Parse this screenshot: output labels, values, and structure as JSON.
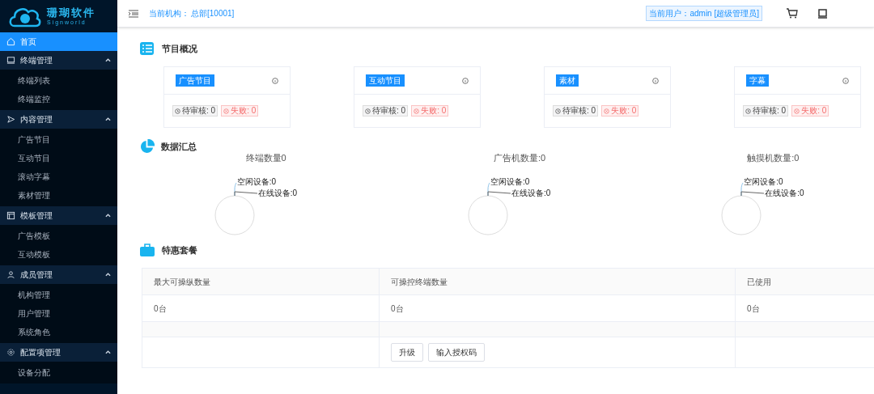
{
  "logo": {
    "name": "珊瑚软件",
    "sub": "Signworld"
  },
  "sidebar": {
    "items": [
      {
        "label": "首页",
        "selected": true
      },
      {
        "label": "终端管理",
        "expanded": true,
        "children": [
          {
            "label": "终端列表",
            "selected": false
          },
          {
            "label": "终端监控",
            "selected": false
          }
        ]
      },
      {
        "label": "内容管理",
        "expanded": true,
        "children": [
          {
            "label": "广告节目",
            "selected": false
          },
          {
            "label": "互动节目",
            "selected": false
          },
          {
            "label": "滚动字幕",
            "selected": false
          },
          {
            "label": "素材管理",
            "selected": false
          }
        ]
      },
      {
        "label": "模板管理",
        "expanded": true,
        "children": [
          {
            "label": "广告模板",
            "selected": false
          },
          {
            "label": "互动模板",
            "selected": false
          }
        ]
      },
      {
        "label": "成员管理",
        "expanded": true,
        "children": [
          {
            "label": "机构管理",
            "selected": false
          },
          {
            "label": "用户管理",
            "selected": false
          },
          {
            "label": "系统角色",
            "selected": false
          }
        ]
      },
      {
        "label": "配置项管理",
        "expanded": true,
        "children": [
          {
            "label": "设备分配",
            "selected": false
          }
        ]
      }
    ]
  },
  "header": {
    "org_label": "当前机构：",
    "org": "总部[10001]",
    "user": "当前用户：admin [超级管理员]"
  },
  "overview": {
    "title": "节目概况",
    "cards": [
      {
        "tag": "广告节目",
        "pending": "待审核: 0",
        "failed": "失败: 0"
      },
      {
        "tag": "互动节目",
        "pending": "待审核: 0",
        "failed": "失败: 0"
      },
      {
        "tag": "素材",
        "pending": "待审核: 0",
        "failed": "失败: 0"
      },
      {
        "tag": "字幕",
        "pending": "待审核: 0",
        "failed": "失败: 0"
      }
    ]
  },
  "summary": {
    "title": "数据汇总",
    "charts": [
      {
        "title": "终端数量0",
        "idle": "空闲设备:0",
        "online": "在线设备:0"
      },
      {
        "title": "广告机数量:0",
        "idle": "空闲设备:0",
        "online": "在线设备:0"
      },
      {
        "title": "触摸机数量:0",
        "idle": "空闲设备:0",
        "online": "在线设备:0"
      }
    ]
  },
  "package": {
    "title": "特惠套餐",
    "columns": [
      "最大可操纵数量",
      "可操控终端数量",
      "已使用"
    ],
    "row": [
      "0台",
      "0台",
      "0台"
    ],
    "buttons": [
      "升级",
      "输入授权码"
    ]
  }
}
